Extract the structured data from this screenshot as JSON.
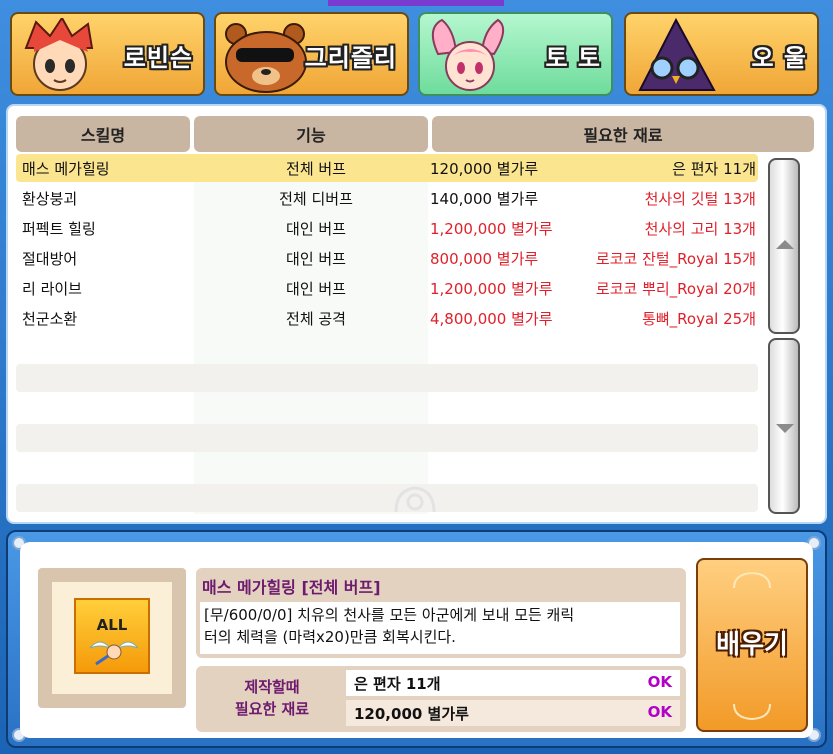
{
  "tabs": [
    {
      "label": "로빈슨",
      "active": false,
      "icon": "robinson-portrait-icon"
    },
    {
      "label": "그리즐리",
      "active": false,
      "icon": "grizzly-portrait-icon"
    },
    {
      "label": "토 토",
      "active": true,
      "icon": "toto-portrait-icon"
    },
    {
      "label": "오 울",
      "active": false,
      "icon": "owl-portrait-icon"
    }
  ],
  "table": {
    "headers": {
      "name": "스킬명",
      "function": "기능",
      "materials": "필요한 재료"
    },
    "rows": [
      {
        "name": "매스 메가힐링",
        "function": "전체 버프",
        "cost": "120,000 별가루",
        "material": "은 편자 11개",
        "cost_red": false,
        "material_red": false,
        "selected": true
      },
      {
        "name": "환상붕괴",
        "function": "전체 디버프",
        "cost": "140,000 별가루",
        "material": "천사의 깃털 13개",
        "cost_red": false,
        "material_red": true,
        "selected": false
      },
      {
        "name": "퍼펙트 힐링",
        "function": "대인 버프",
        "cost": "1,200,000 별가루",
        "material": "천사의 고리 13개",
        "cost_red": true,
        "material_red": true,
        "selected": false
      },
      {
        "name": "절대방어",
        "function": "대인 버프",
        "cost": "800,000 별가루",
        "material": "로코코 잔털_Royal 15개",
        "cost_red": true,
        "material_red": true,
        "selected": false
      },
      {
        "name": "리 라이브",
        "function": "대인 버프",
        "cost": "1,200,000 별가루",
        "material": "로코코 뿌리_Royal 20개",
        "cost_red": true,
        "material_red": true,
        "selected": false
      },
      {
        "name": "천군소환",
        "function": "전체 공격",
        "cost": "4,800,000 별가루",
        "material": "통뼈_Royal 25개",
        "cost_red": true,
        "material_red": true,
        "selected": false
      }
    ]
  },
  "detail": {
    "icon_text": "ALL",
    "title": "매스 메가힐링 [전체 버프]",
    "description_line1": "[무/600/0/0] 치유의 천사를 모든 아군에게 보내 모든 캐릭",
    "description_line2": "터의 체력을 (마력x20)만큼 회복시킨다.",
    "required_label_line1": "제작할때",
    "required_label_line2": "필요한 재료",
    "requirements": [
      {
        "name": "은 편자 11개",
        "status": "OK"
      },
      {
        "name": "120,000 별가루",
        "status": "OK"
      }
    ],
    "learn_button": "배우기"
  },
  "colors": {
    "red": "#e0202a",
    "ok": "#b300c8",
    "title_purple": "#6e1a6e",
    "selected_row": "#fbe58e"
  }
}
